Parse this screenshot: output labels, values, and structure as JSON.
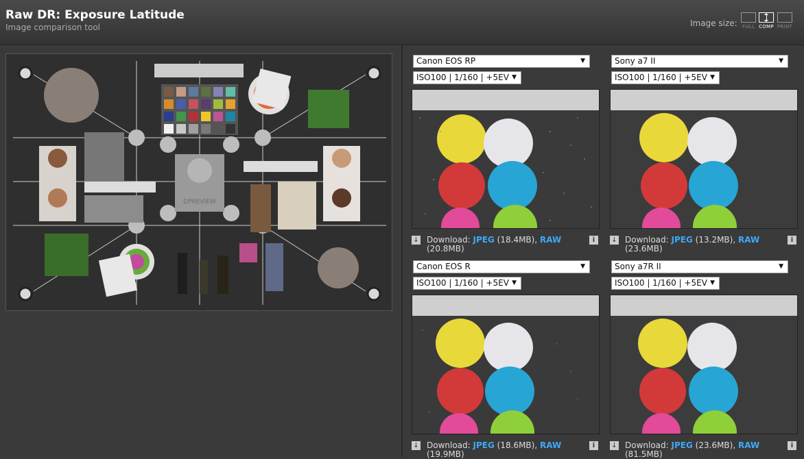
{
  "header": {
    "title": "Raw DR: Exposure Latitude",
    "subtitle": "Image comparison tool",
    "size_label": "Image size:",
    "size_options": [
      {
        "label": "FULL",
        "active": false
      },
      {
        "label": "COMP",
        "active": true
      },
      {
        "label": "PRINT",
        "active": false
      }
    ]
  },
  "scene": {
    "chart_brand": "DPREVIEW"
  },
  "download": {
    "prefix": "Download:",
    "jpeg_label": "JPEG",
    "raw_label": "RAW",
    "info_glyph": "i"
  },
  "panels": [
    {
      "camera": "Canon EOS RP",
      "settings": "ISO100 | 1/160 | +5EV",
      "jpeg_size": "(18.4MB),",
      "raw_size": "(20.8MB)",
      "noise": "high"
    },
    {
      "camera": "Sony a7 II",
      "settings": "ISO100 | 1/160 | +5EV",
      "jpeg_size": "(13.2MB),",
      "raw_size": "(23.6MB)",
      "noise": "low"
    },
    {
      "camera": "Canon EOS R",
      "settings": "ISO100 | 1/160 | +5EV",
      "jpeg_size": "(18.6MB),",
      "raw_size": "(19.9MB)",
      "noise": "medium"
    },
    {
      "camera": "Sony a7R II",
      "settings": "ISO100 | 1/160 | +5EV",
      "jpeg_size": "(23.6MB),",
      "raw_size": "(81.5MB)",
      "noise": "low"
    }
  ],
  "colors": {
    "link": "#3fa9f5",
    "yellow": "#e8d83a",
    "white": "#e6e6ea",
    "red": "#d23a3a",
    "cyan": "#27a6d6",
    "green": "#8fcf3a",
    "pink": "#e24a9a"
  }
}
